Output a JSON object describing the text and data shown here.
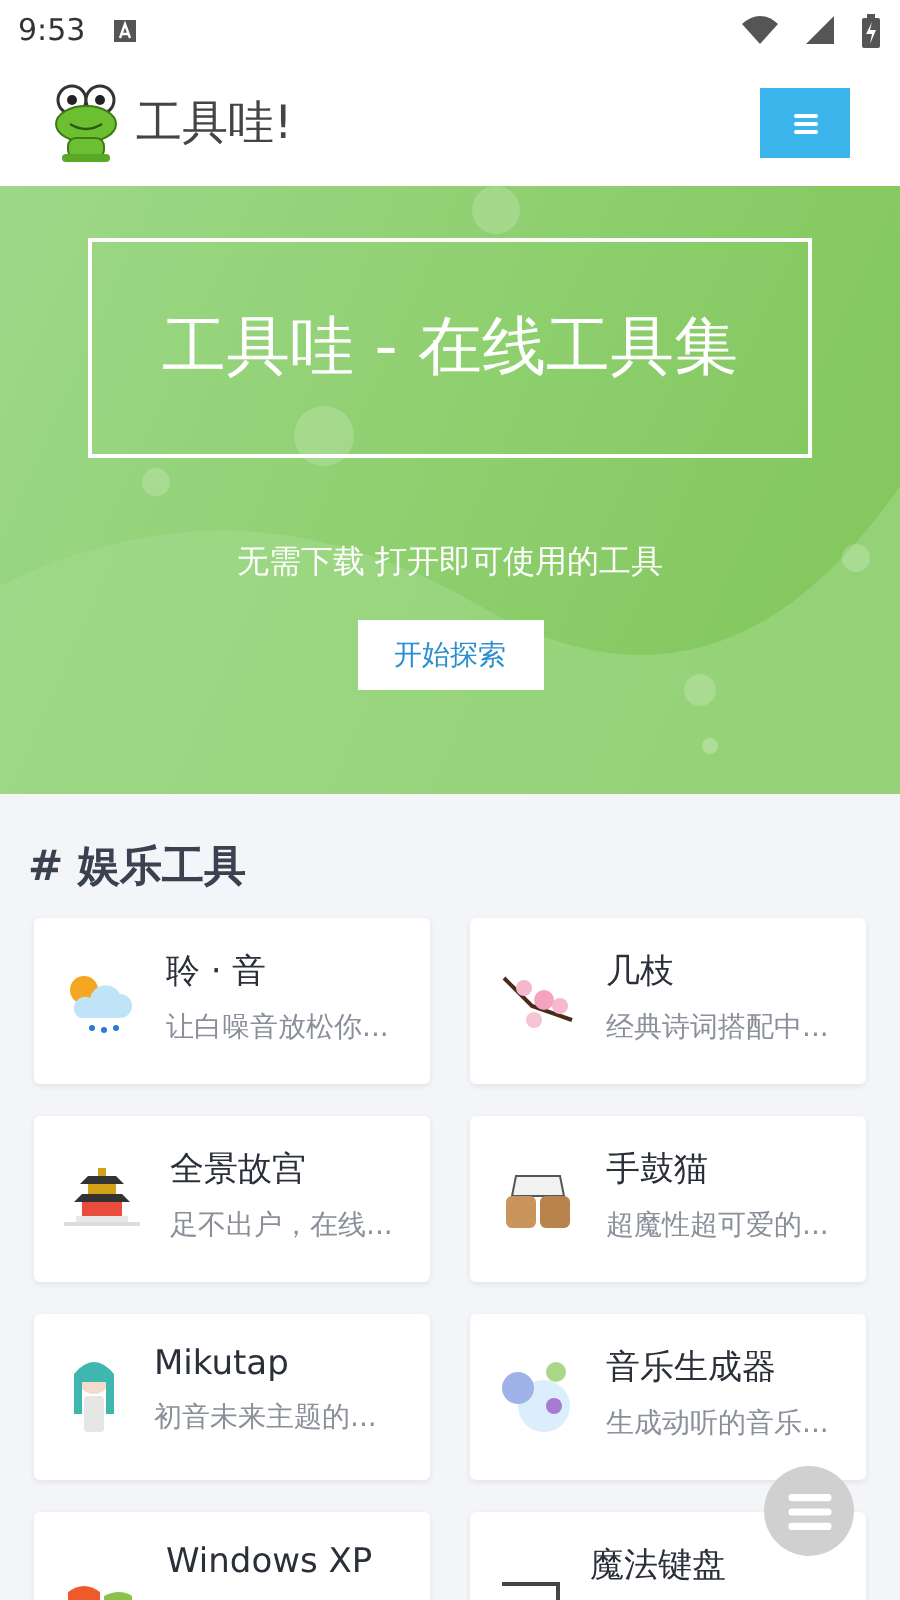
{
  "status_bar": {
    "time": "9:53"
  },
  "header": {
    "title": "工具哇!"
  },
  "hero": {
    "title": "工具哇 - 在线工具集",
    "subtitle": "无需下载 打开即可使用的工具",
    "button": "开始探索"
  },
  "section": {
    "heading": "# 娱乐工具",
    "cards": [
      {
        "title": "聆 · 音",
        "description": "让白噪音放松你..."
      },
      {
        "title": "几枝",
        "description": "经典诗词搭配中..."
      },
      {
        "title": "全景故宫",
        "description": "足不出户，在线..."
      },
      {
        "title": "手鼓猫",
        "description": "超魔性超可爱的..."
      },
      {
        "title": "Mikutap",
        "description": "初音未来主题的..."
      },
      {
        "title": "音乐生成器",
        "description": "生成动听的音乐..."
      },
      {
        "title": "Windows XP"
      },
      {
        "title": "魔法键盘"
      }
    ]
  }
}
